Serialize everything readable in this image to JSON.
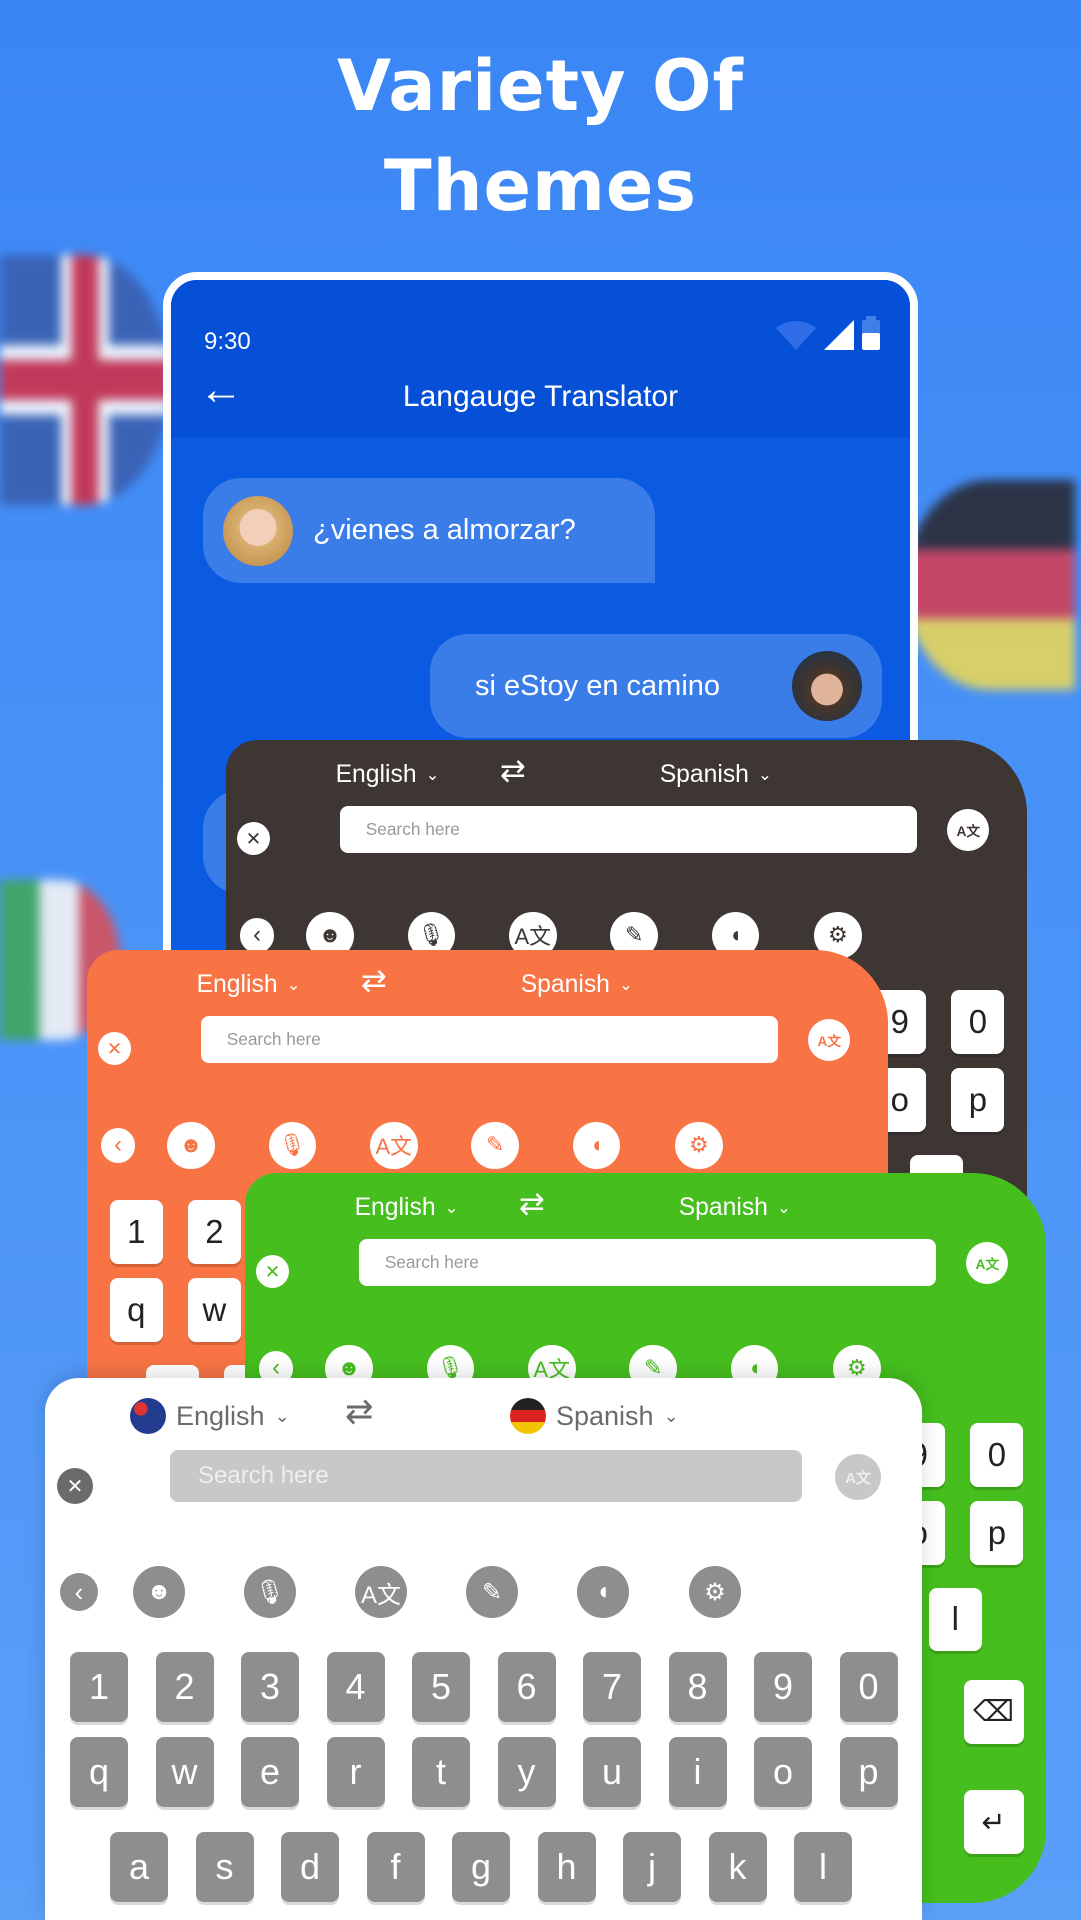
{
  "hero": {
    "line1": "Variety Of",
    "line2": "Themes"
  },
  "phone": {
    "time": "9:30",
    "title": "Langauge Translator",
    "back_icon": "arrow-left-icon",
    "messages": [
      {
        "text": "¿vienes a almorzar?",
        "side": "left"
      },
      {
        "text": "si eStoy en camino",
        "side": "right"
      }
    ]
  },
  "colors": {
    "background": "#3a86f5",
    "header": "#0550d6",
    "bubble": "#3b7de8"
  },
  "keyboard_common": {
    "source_lang": "English",
    "target_lang": "Spanish",
    "search_placeholder": "Search here",
    "toolbar_icons": [
      "back-icon",
      "emoji-icon",
      "voice-translate-icon",
      "translate-icon",
      "theme-palette-icon",
      "speak-icon",
      "settings-icon"
    ],
    "rows": [
      [
        "1",
        "2",
        "3",
        "4",
        "5",
        "6",
        "7",
        "8",
        "9",
        "0"
      ],
      [
        "q",
        "w",
        "e",
        "r",
        "t",
        "y",
        "u",
        "i",
        "o",
        "p"
      ],
      [
        "a",
        "s",
        "d",
        "f",
        "g",
        "h",
        "j",
        "k",
        "l"
      ]
    ],
    "backspace_icon": "backspace-icon",
    "enter_icon": "enter-icon"
  },
  "keyboards": [
    {
      "theme": "dark",
      "bg": "#3d3633",
      "fg": "#ffffff",
      "key_bg": "#ffffff",
      "key_fg": "#222222",
      "icon_bg": "#ffffff",
      "icon_fg": "#3d3633"
    },
    {
      "theme": "orange",
      "bg": "#f87444",
      "fg": "#ffffff",
      "key_bg": "#ffffff",
      "key_fg": "#222222",
      "icon_bg": "#ffffff",
      "icon_fg": "#f87444"
    },
    {
      "theme": "green",
      "bg": "#45be1e",
      "fg": "#ffffff",
      "key_bg": "#ffffff",
      "key_fg": "#222222",
      "icon_bg": "#ffffff",
      "icon_fg": "#45be1e"
    },
    {
      "theme": "light",
      "bg": "#ffffff",
      "fg": "#6b6b6b",
      "key_bg": "#8e8e8e",
      "key_fg": "#ffffff",
      "icon_bg": "#8e8e8e",
      "icon_fg": "#ffffff"
    }
  ]
}
